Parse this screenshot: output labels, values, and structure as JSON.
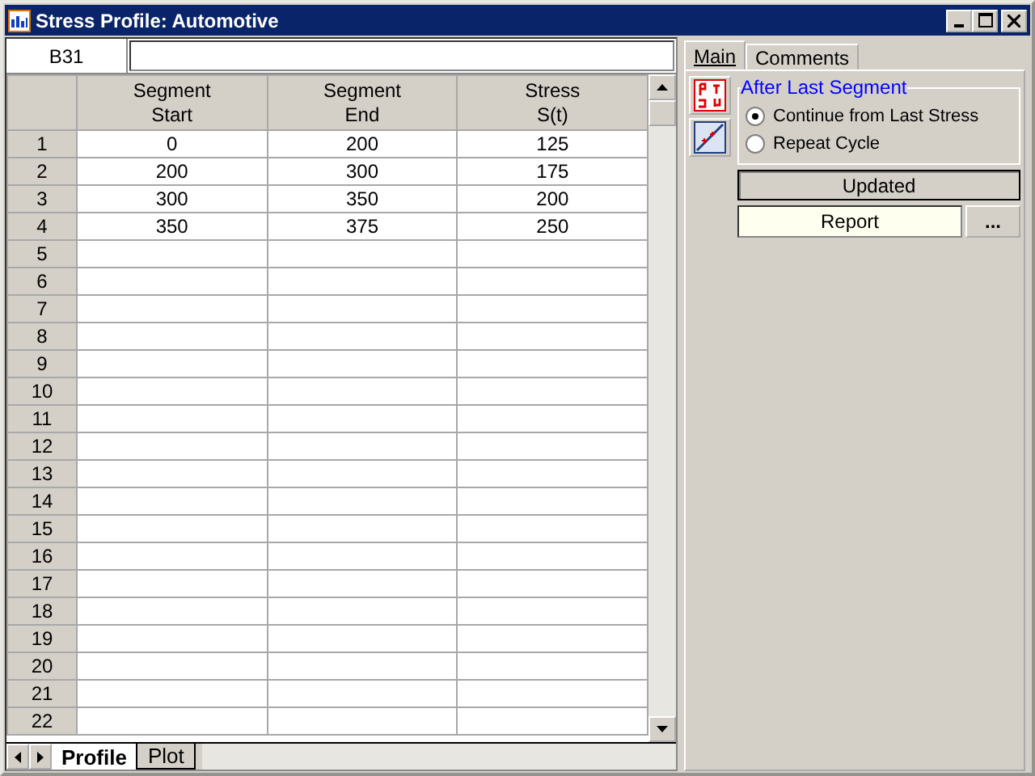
{
  "window": {
    "title": "Stress Profile: Automotive"
  },
  "cell_reference": "B31",
  "table": {
    "columns": [
      {
        "lines": [
          "Segment",
          "Start"
        ]
      },
      {
        "lines": [
          "Segment",
          "End"
        ]
      },
      {
        "lines": [
          "Stress",
          "S(t)"
        ]
      }
    ],
    "rows": [
      {
        "number": "1",
        "cells": [
          "0",
          "200",
          "125"
        ]
      },
      {
        "number": "2",
        "cells": [
          "200",
          "300",
          "175"
        ]
      },
      {
        "number": "3",
        "cells": [
          "300",
          "350",
          "200"
        ]
      },
      {
        "number": "4",
        "cells": [
          "350",
          "375",
          "250"
        ]
      },
      {
        "number": "5"
      },
      {
        "number": "6"
      },
      {
        "number": "7"
      },
      {
        "number": "8"
      },
      {
        "number": "9"
      },
      {
        "number": "10"
      },
      {
        "number": "11"
      },
      {
        "number": "12"
      },
      {
        "number": "13"
      },
      {
        "number": "14"
      },
      {
        "number": "15"
      },
      {
        "number": "16"
      },
      {
        "number": "17"
      },
      {
        "number": "18"
      },
      {
        "number": "19"
      },
      {
        "number": "20"
      },
      {
        "number": "21"
      },
      {
        "number": "22"
      }
    ]
  },
  "sheet_tabs": [
    {
      "label": "Profile",
      "selected": true
    },
    {
      "label": "Plot",
      "selected": false
    }
  ],
  "panel_tabs": [
    {
      "label": "Main",
      "selected": true
    },
    {
      "label": "Comments",
      "selected": false
    }
  ],
  "after_last_segment": {
    "title": "After Last Segment",
    "options": [
      {
        "label": "Continue from Last Stress",
        "selected": true
      },
      {
        "label": "Repeat Cycle",
        "selected": false
      }
    ]
  },
  "status": "Updated",
  "report": {
    "label": "Report",
    "button": "..."
  }
}
